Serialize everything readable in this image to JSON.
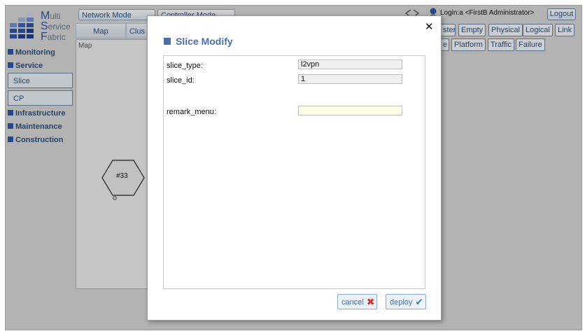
{
  "logo": {
    "line1_initial": "M",
    "line1_rest": "ulti",
    "line2_initial": "S",
    "line2_rest": "ervice",
    "line3_initial": "F",
    "line3_rest": "abric"
  },
  "header": {
    "mode_buttons": [
      "Network Mode",
      "Controller Mode"
    ],
    "login_text": "Login:a <FirstB Administrator>",
    "logout_label": "Logout",
    "row1_buttons": [
      "ster",
      "Empty",
      "Physical",
      "Logical",
      "Link"
    ],
    "row2_buttons": [
      "e",
      "Platform",
      "Traffic",
      "Failure"
    ]
  },
  "tabs": [
    "Map",
    "Clus"
  ],
  "sidebar": {
    "sections": [
      "Monitoring",
      "Service",
      "Infrastructure",
      "Maintenance",
      "Construction"
    ],
    "service_items": [
      "Slice",
      "CP"
    ]
  },
  "map": {
    "label": "Map",
    "node_label": "#33"
  },
  "modal": {
    "title": "Slice Modify",
    "close_glyph": "✕",
    "fields": [
      {
        "label": "slice_type:",
        "value": "l2vpn"
      },
      {
        "label": "slice_id:",
        "value": "1"
      },
      {
        "label": "remark_menu:",
        "value": ""
      }
    ],
    "cancel_label": "cancel",
    "deploy_label": "deploy",
    "cancel_icon": "✖",
    "deploy_icon": "✔"
  },
  "colors": {
    "accent": "#4a6fae",
    "cancel_red": "#e0302a",
    "deploy_blue": "#3f7fd1",
    "input_yellow": "#fefee8"
  }
}
